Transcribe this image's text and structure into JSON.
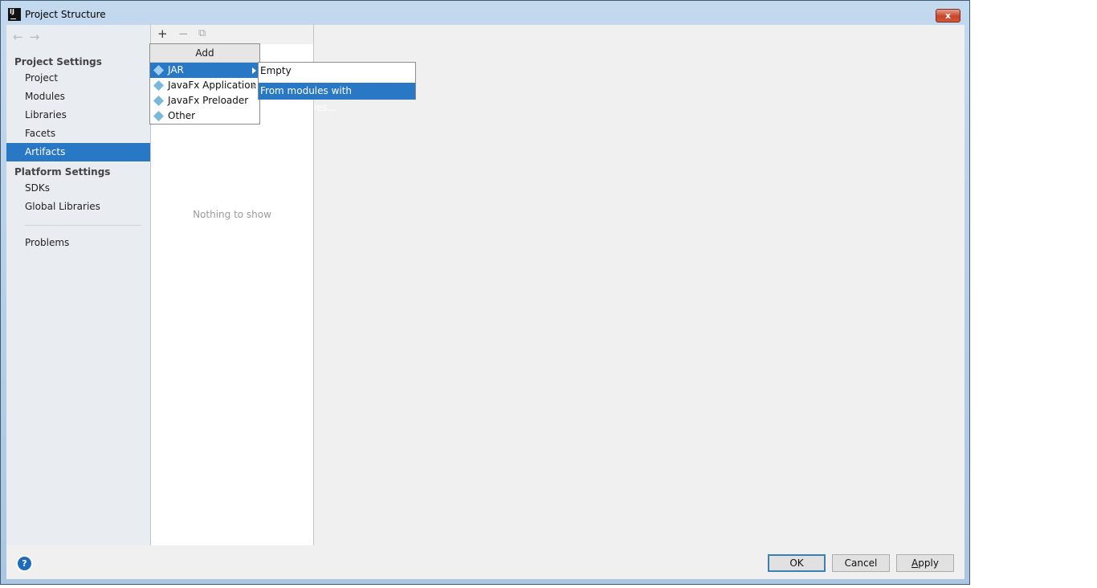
{
  "window": {
    "title": "Project Structure",
    "app_icon": "intellij-idea-icon",
    "close_label": "x"
  },
  "nav": {
    "back_icon": "←",
    "forward_icon": "→"
  },
  "sidebar": {
    "project_settings_header": "Project Settings",
    "project_items": [
      {
        "label": "Project"
      },
      {
        "label": "Modules"
      },
      {
        "label": "Libraries"
      },
      {
        "label": "Facets"
      },
      {
        "label": "Artifacts",
        "selected": true
      }
    ],
    "platform_settings_header": "Platform Settings",
    "platform_items": [
      {
        "label": "SDKs"
      },
      {
        "label": "Global Libraries"
      }
    ],
    "problems_label": "Problems"
  },
  "toolbar": {
    "add_icon": "+",
    "remove_icon": "−",
    "copy_icon": "⧉"
  },
  "artifacts_list": {
    "empty_text": "Nothing to show"
  },
  "add_popup": {
    "header": "Add",
    "items": [
      {
        "label": "JAR",
        "selected": true,
        "has_submenu": true
      },
      {
        "label": "JavaFx Application",
        "has_submenu": true
      },
      {
        "label": "JavaFx Preloader"
      },
      {
        "label": "Other"
      }
    ]
  },
  "jar_submenu": {
    "items": [
      {
        "label": "Empty"
      },
      {
        "label": "From modules with dependencies...",
        "selected": true
      }
    ]
  },
  "footer": {
    "help_label": "?",
    "ok_label": "OK",
    "cancel_label": "Cancel",
    "apply_label_prefix": "A",
    "apply_label_rest": "pply"
  },
  "colors": {
    "selection": "#2978c6",
    "sidebar_bg": "#e9ecf0",
    "dialog_bg": "#f0f0f0"
  }
}
